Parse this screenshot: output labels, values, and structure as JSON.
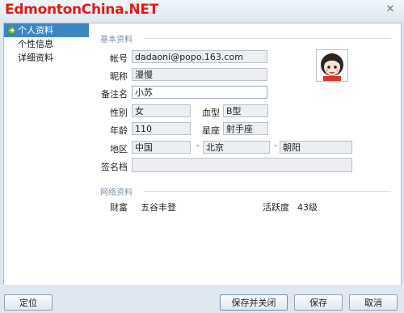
{
  "brand": "EdmontonChina.NET",
  "sidebar": {
    "items": [
      {
        "label": "个人资料",
        "selected": true
      },
      {
        "label": "个性信息",
        "selected": false
      },
      {
        "label": "详细资料",
        "selected": false
      }
    ]
  },
  "basic": {
    "section_title": "基本资料",
    "account_label": "帐号",
    "account_value": "dadaoni@popo.163.com",
    "nickname_label": "昵称",
    "nickname_value": "漫慢",
    "remark_label": "备注名",
    "remark_value": "小苏",
    "gender_label": "性别",
    "gender_value": "女",
    "blood_label": "血型",
    "blood_value": "B型",
    "age_label": "年龄",
    "age_value": "110",
    "star_label": "星座",
    "star_value": "射手座",
    "region_label": "地区",
    "region_country": "中国",
    "region_province": "北京",
    "region_city": "朝阳",
    "region_sep": "-",
    "signature_label": "签名档",
    "signature_value": ""
  },
  "network": {
    "section_title": "网络资料",
    "wealth_label": "财富",
    "wealth_value": "五谷丰登",
    "activity_label": "活跃度",
    "activity_value": "43级"
  },
  "buttons": {
    "locate": "定位",
    "save_close": "保存并关闭",
    "save": "保存",
    "cancel": "取消"
  },
  "colors": {
    "brand": "#e21d12",
    "selection": "#3d86c6",
    "background": "#dfe7f1"
  }
}
